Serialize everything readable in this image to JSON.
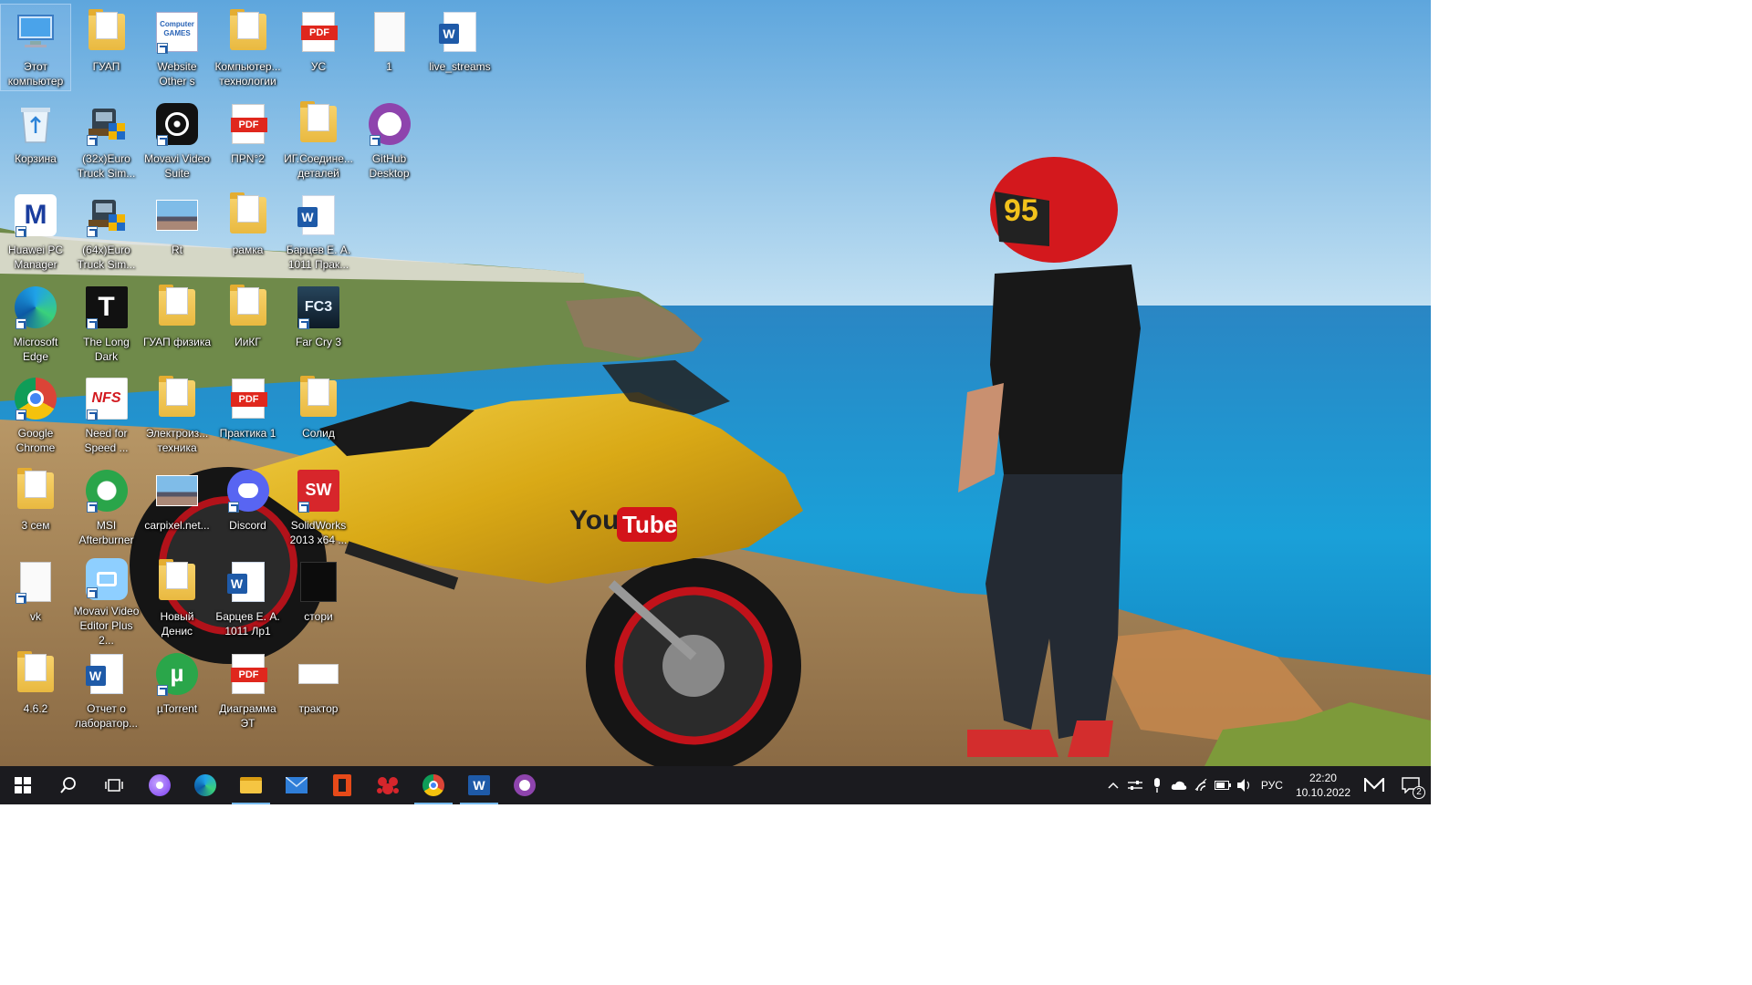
{
  "desktop": {
    "icons": [
      {
        "id": "this-pc",
        "label": "Этот\nкомпьютер",
        "glyph": "pc",
        "selected": true
      },
      {
        "id": "guap",
        "label": "ГУАП",
        "glyph": "folder"
      },
      {
        "id": "website-other",
        "label": "Website\nOther s",
        "glyph": "cgames",
        "text": "Computer\nGAMES",
        "shortcut": true
      },
      {
        "id": "komp-tech",
        "label": "Компьютер...\nтехнологии",
        "glyph": "folder"
      },
      {
        "id": "us",
        "label": "УС",
        "glyph": "pdf",
        "text": "PDF"
      },
      {
        "id": "file-1",
        "label": "1",
        "glyph": "blank"
      },
      {
        "id": "live-streams",
        "label": "live_streams",
        "glyph": "word",
        "text": "W"
      },
      {
        "id": "recycle-bin",
        "label": "Корзина",
        "glyph": "recycle"
      },
      {
        "id": "euro-truck-32",
        "label": "(32x)Euro\nTruck Sim...",
        "glyph": "truck",
        "shortcut": true
      },
      {
        "id": "movavi-suite",
        "label": "Movavi Video\nSuite",
        "glyph": "movavi",
        "shortcut": true
      },
      {
        "id": "prn2",
        "label": "ПРN°2",
        "glyph": "pdf",
        "text": "PDF"
      },
      {
        "id": "ig-soed",
        "label": "ИГ.Соедине...\nдеталей",
        "glyph": "folder"
      },
      {
        "id": "github-desktop",
        "label": "GitHub\nDesktop",
        "glyph": "github",
        "shortcut": true
      },
      {
        "id": "huawei-pc",
        "label": "Huawei PC\nManager",
        "glyph": "huawei",
        "text": "M",
        "shortcut": true
      },
      {
        "id": "euro-truck-64",
        "label": "(64x)Euro\nTruck Sim...",
        "glyph": "truck",
        "shortcut": true
      },
      {
        "id": "rt",
        "label": "Rt",
        "glyph": "photo"
      },
      {
        "id": "ramka",
        "label": "рамка",
        "glyph": "folder"
      },
      {
        "id": "bartsev-prak",
        "label": "Барцев Е. А.\n1011 Прак...",
        "glyph": "word",
        "text": "W"
      },
      {
        "id": "edge",
        "label": "Microsoft\nEdge",
        "glyph": "edge",
        "shortcut": true
      },
      {
        "id": "long-dark",
        "label": "The Long\nDark",
        "glyph": "longdark",
        "text": "T",
        "shortcut": true
      },
      {
        "id": "guap-fizika",
        "label": "ГУАП физика",
        "glyph": "folder"
      },
      {
        "id": "ikg",
        "label": "ИиКГ",
        "glyph": "folder"
      },
      {
        "id": "farcry3",
        "label": "Far Cry 3",
        "glyph": "fc3",
        "text": "FC3",
        "shortcut": true
      },
      {
        "id": "chrome",
        "label": "Google\nChrome",
        "glyph": "chrome",
        "shortcut": true
      },
      {
        "id": "nfs",
        "label": "Need for\nSpeed ...",
        "glyph": "nfs",
        "text": "NFS",
        "shortcut": true
      },
      {
        "id": "elektro",
        "label": "Электроиз...\nтехника",
        "glyph": "folder"
      },
      {
        "id": "praktika1",
        "label": "Практика 1",
        "glyph": "pdf",
        "text": "PDF"
      },
      {
        "id": "solid",
        "label": "Солид",
        "glyph": "folder"
      },
      {
        "id": "sem3",
        "label": "3 сем",
        "glyph": "folder"
      },
      {
        "id": "msi",
        "label": "MSI\nAfterburner",
        "glyph": "xbox",
        "shortcut": true
      },
      {
        "id": "carpixel",
        "label": "carpixel.net...",
        "glyph": "photo"
      },
      {
        "id": "discord",
        "label": "Discord",
        "glyph": "discord",
        "shortcut": true
      },
      {
        "id": "solidworks",
        "label": "SolidWorks\n2013 x64 ...",
        "glyph": "sw",
        "text": "SW",
        "shortcut": true
      },
      {
        "id": "vk",
        "label": "vk",
        "glyph": "blank",
        "shortcut": true
      },
      {
        "id": "movavi-editor",
        "label": "Movavi Video\nEditor Plus 2...",
        "glyph": "movavi-editor",
        "shortcut": true
      },
      {
        "id": "novy-denis",
        "label": "Новый\nДенис",
        "glyph": "folder"
      },
      {
        "id": "bartsev-lr1",
        "label": "Барцев Е. А.\n1011 Лр1",
        "glyph": "word",
        "text": "W"
      },
      {
        "id": "stori",
        "label": "стори",
        "glyph": "dark"
      },
      {
        "id": "v462",
        "label": "4.6.2",
        "glyph": "folder"
      },
      {
        "id": "otchet",
        "label": "Отчет о\nлаборатор...",
        "glyph": "word",
        "text": "W"
      },
      {
        "id": "utorrent",
        "label": "µTorrent",
        "glyph": "utorrent",
        "text": "µ",
        "shortcut": true
      },
      {
        "id": "diagramma",
        "label": "Диаграмма\nЭТ",
        "glyph": "pdf",
        "text": "PDF"
      },
      {
        "id": "traktor",
        "label": "трактор",
        "glyph": "traktor"
      }
    ]
  },
  "taskbar": {
    "start_icon": "windows-start-icon",
    "items": [
      {
        "id": "search",
        "icon": "search-icon"
      },
      {
        "id": "task-view",
        "icon": "task-view-icon"
      },
      {
        "id": "alice",
        "icon": "alice-icon"
      },
      {
        "id": "edge",
        "icon": "edge-icon"
      },
      {
        "id": "explorer",
        "icon": "folder-icon",
        "active": true
      },
      {
        "id": "mail",
        "icon": "mail-icon"
      },
      {
        "id": "office",
        "icon": "office-icon"
      },
      {
        "id": "app-red",
        "icon": "red-app-icon"
      },
      {
        "id": "chrome",
        "icon": "chrome-icon",
        "active": true
      },
      {
        "id": "word",
        "icon": "word-icon",
        "active": true
      },
      {
        "id": "github",
        "icon": "github-icon"
      }
    ],
    "tray": {
      "language": "РУС",
      "time": "22:20",
      "date": "10.10.2022",
      "notifications": "2"
    }
  },
  "wallpaper": {
    "helmet_text": "95",
    "bike_text_you": "You",
    "bike_text_tube": "Tube"
  },
  "colors": {
    "taskbar": "#1b1b1f",
    "sky_top": "#5fa7dc",
    "sea": "#1f8fd0",
    "accent": "#76b9ed"
  }
}
